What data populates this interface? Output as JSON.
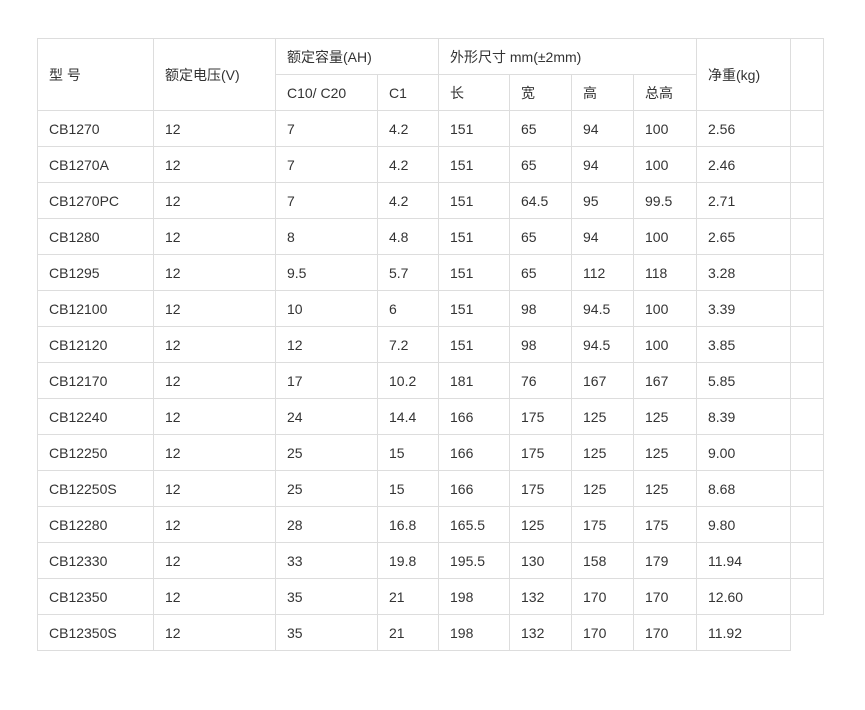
{
  "table": {
    "headers": {
      "model": "型 号",
      "voltage": "额定电压(V)",
      "capacity": "额定容量(AH)",
      "capacity_c10": "C10/ C20",
      "capacity_c1": "C1",
      "dimensions": "外形尺寸 mm(±2mm)",
      "length": "长",
      "width": "宽",
      "height": "高",
      "total_height": "总高",
      "weight": "净重(kg)"
    },
    "rows": [
      [
        "CB1270",
        "12",
        "7",
        "4.2",
        "151",
        "65",
        "94",
        "100",
        "2.56"
      ],
      [
        "CB1270A",
        "12",
        "7",
        "4.2",
        "151",
        "65",
        "94",
        "100",
        "2.46"
      ],
      [
        "CB1270PC",
        "12",
        "7",
        "4.2",
        "151",
        "64.5",
        "95",
        "99.5",
        "2.71"
      ],
      [
        "CB1280",
        "12",
        "8",
        "4.8",
        "151",
        "65",
        "94",
        "100",
        "2.65"
      ],
      [
        "CB1295",
        "12",
        "9.5",
        "5.7",
        "151",
        "65",
        "112",
        "118",
        "3.28"
      ],
      [
        "CB12100",
        "12",
        "10",
        "6",
        "151",
        "98",
        "94.5",
        "100",
        "3.39"
      ],
      [
        "CB12120",
        "12",
        "12",
        "7.2",
        "151",
        "98",
        "94.5",
        "100",
        "3.85"
      ],
      [
        "CB12170",
        "12",
        "17",
        "10.2",
        "181",
        "76",
        "167",
        "167",
        "5.85"
      ],
      [
        "CB12240",
        "12",
        "24",
        "14.4",
        "166",
        "175",
        "125",
        "125",
        "8.39"
      ],
      [
        "CB12250",
        "12",
        "25",
        "15",
        "166",
        "175",
        "125",
        "125",
        "9.00"
      ],
      [
        "CB12250S",
        "12",
        "25",
        "15",
        "166",
        "175",
        "125",
        "125",
        "8.68"
      ],
      [
        "CB12280",
        "12",
        "28",
        "16.8",
        "165.5",
        "125",
        "175",
        "175",
        "9.80"
      ],
      [
        "CB12330",
        "12",
        "33",
        "19.8",
        "195.5",
        "130",
        "158",
        "179",
        "11.94"
      ],
      [
        "CB12350",
        "12",
        "35",
        "21",
        "198",
        "132",
        "170",
        "170",
        "12.60"
      ],
      [
        "CB12350S",
        "12",
        "35",
        "21",
        "198",
        "132",
        "170",
        "170",
        "11.92"
      ]
    ]
  }
}
